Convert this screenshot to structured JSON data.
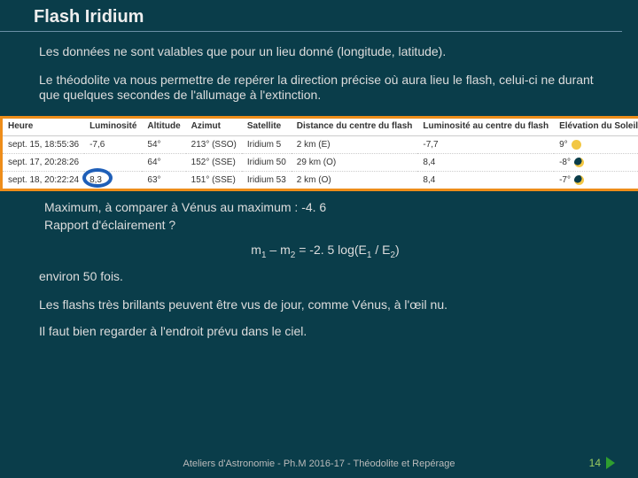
{
  "title": "Flash Iridium",
  "intro1": "Les données ne sont valables que pour un lieu donné (longitude, latitude).",
  "intro2": "Le théodolite va nous permettre de repérer la direction précise où aura lieu le flash, celui-ci ne durant que quelques secondes de l'allumage à l'extinction.",
  "table": {
    "headers": [
      "Heure",
      "Luminosité",
      "Altitude",
      "Azimut",
      "Satellite",
      "Distance du centre du flash",
      "Luminosité au centre du flash",
      "Elévation du Soleil"
    ],
    "rows": [
      {
        "heure": "sept. 15, 18:55:36",
        "lum": "-7,6",
        "alt": "54°",
        "az": "213° (SSO)",
        "sat": "Iridium 5",
        "dist": "2 km (E)",
        "lumc": "-7,7",
        "elev": "9°",
        "icon": "sun"
      },
      {
        "heure": "sept. 17, 20:28:26",
        "lum": "",
        "alt": "64°",
        "az": "152° (SSE)",
        "sat": "Iridium 50",
        "dist": "29 km (O)",
        "lumc": "8,4",
        "elev": "-8°",
        "icon": "moon"
      },
      {
        "heure": "sept. 18, 20:22:24",
        "lum": "8,3",
        "alt": "63°",
        "az": "151° (SSE)",
        "sat": "Iridium 53",
        "dist": "2 km (O)",
        "lumc": "8,4",
        "elev": "-7°",
        "icon": "moon"
      }
    ]
  },
  "max_line": "Maximum,  à comparer à Vénus au maximum : -4. 6",
  "rapport": "Rapport d'éclairement ?",
  "formula_m1": "m",
  "formula_s1": "1",
  "formula_mid": " – m",
  "formula_s2": "2",
  "formula_eq": " = -2. 5 log(E",
  "formula_e1s": "1",
  "formula_div": " / E",
  "formula_e2s": "2",
  "formula_end": ")",
  "env50": "environ 50 fois.",
  "flashday": "Les flashs très brillants peuvent être vus de jour, comme Vénus, à l'œil nu.",
  "lookup": "Il faut bien regarder à l'endroit prévu dans le ciel.",
  "footer": "Ateliers d'Astronomie - Ph.M 2016-17 - Théodolite et Repérage",
  "page": "14"
}
